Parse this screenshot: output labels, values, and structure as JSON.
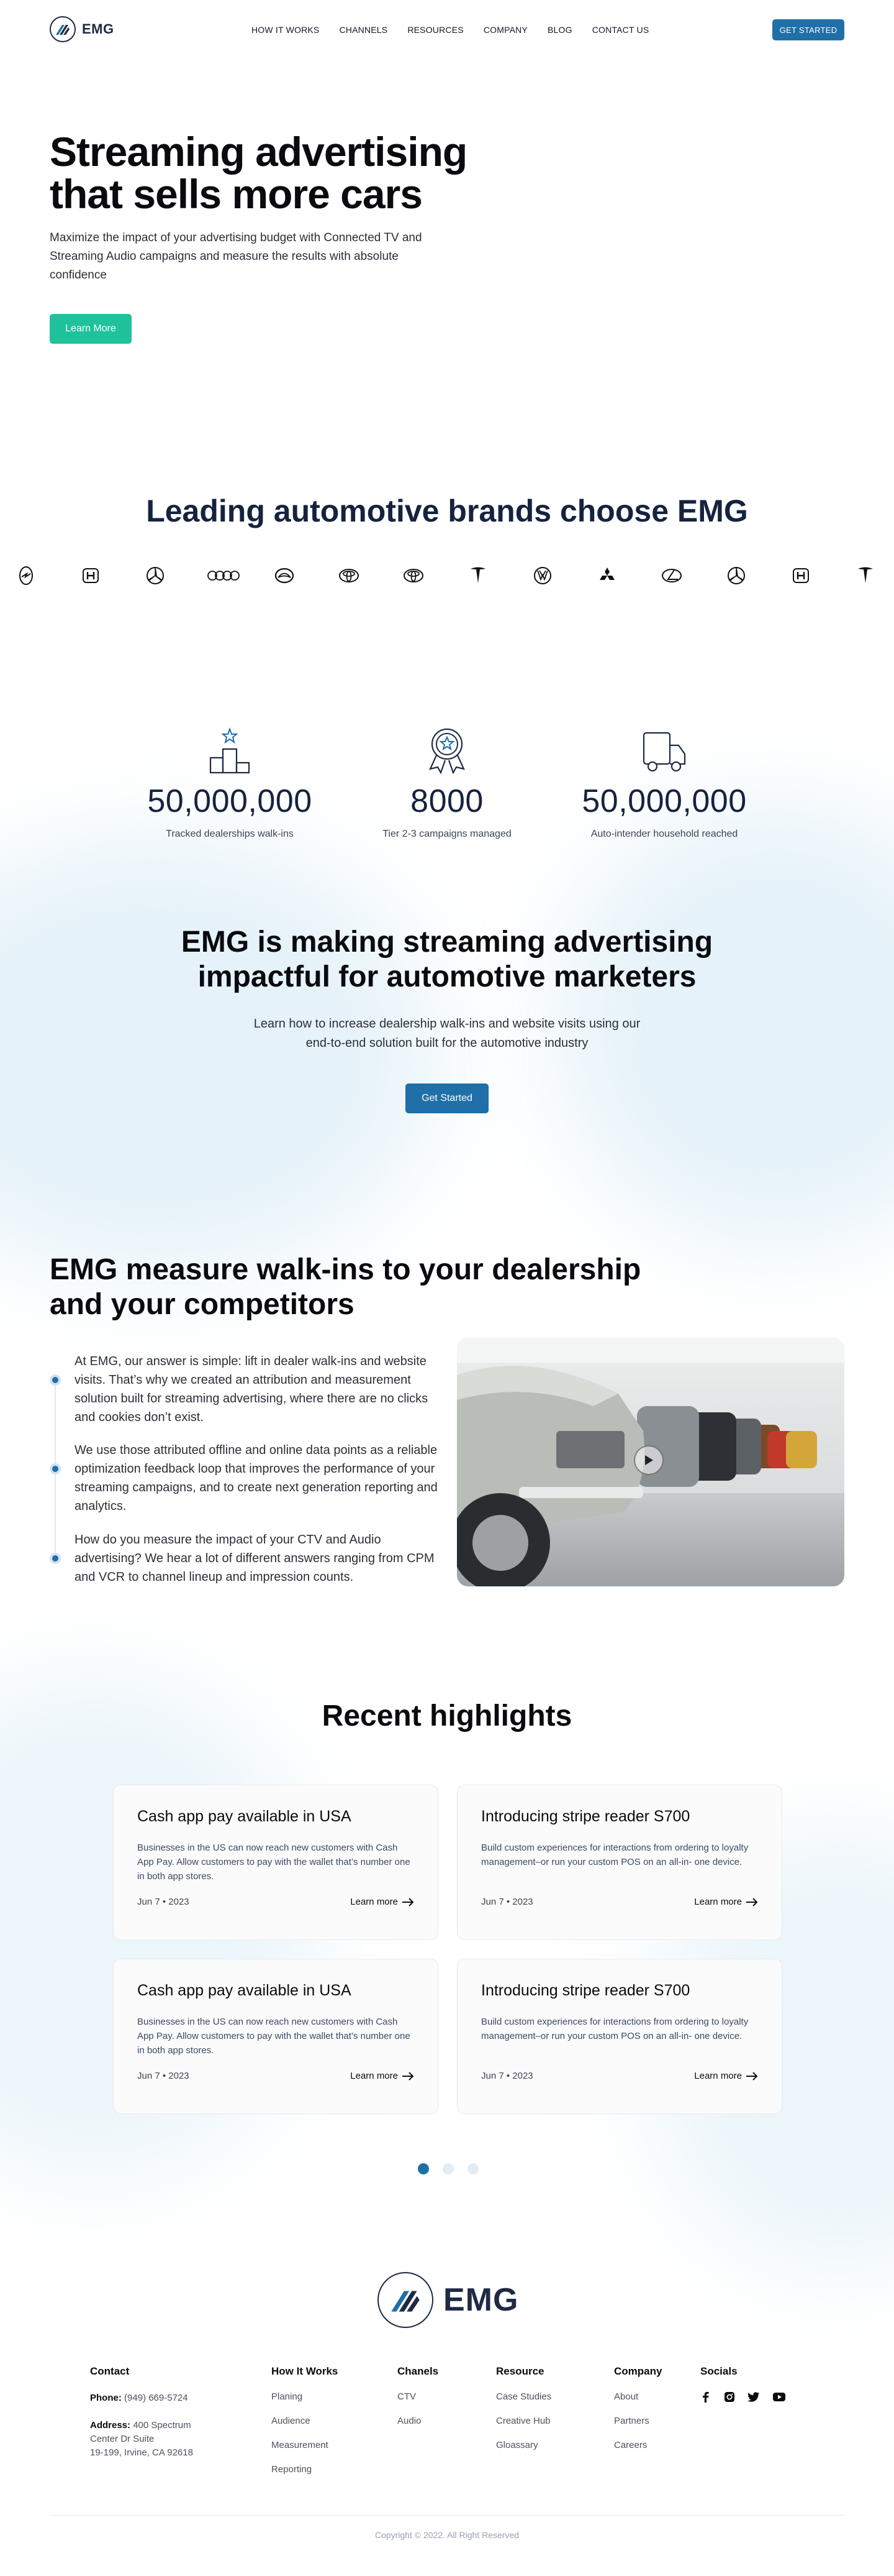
{
  "brand": {
    "name": "EMG"
  },
  "nav": {
    "links": [
      "HOW IT WORKS",
      "CHANNELS",
      "RESOURCES",
      "COMPANY",
      "BLOG",
      "CONTACT US"
    ],
    "cta": "GET STARTED"
  },
  "hero": {
    "title": "Streaming advertising that sells more cars",
    "subtitle": "Maximize the impact of your advertising budget with Connected TV and Streaming Audio campaigns and measure the results with absolute confidence",
    "button": "Learn More"
  },
  "brands": {
    "title": "Leading automotive brands choose EMG",
    "logos": [
      "opel-icon",
      "honda-icon",
      "mercedes-icon",
      "audi-icon",
      "mazda-icon",
      "toyota-icon",
      "toyota-icon",
      "tesla-icon",
      "volkswagen-icon",
      "mitsubishi-icon",
      "lexus-icon",
      "mercedes-icon",
      "honda-icon",
      "tesla-icon"
    ]
  },
  "stats": [
    {
      "icon": "podium-icon",
      "value": "50,000,000",
      "label": "Tracked dealerships walk-ins"
    },
    {
      "icon": "award-icon",
      "value": "8000",
      "label": "Tier 2-3 campaigns managed"
    },
    {
      "icon": "truck-icon",
      "value": "50,000,000",
      "label": "Auto-intender household reached"
    }
  ],
  "mission": {
    "title": "EMG is making streaming advertising impactful for automotive marketers",
    "subtitle": "Learn how to increase dealership walk-ins and website visits using our end-to-end solution built for the automotive industry",
    "button": "Get Started"
  },
  "measure": {
    "title": "EMG measure walk-ins to your dealership and your competitors",
    "points": [
      "At EMG, our answer is simple: lift in dealer walk-ins and website visits. That’s why we created an attribution and measurement solution built for streaming advertising, where there are no clicks and cookies don’t exist.",
      "We use those attributed offline and online data points as a reliable optimization feedback loop that improves the performance of your streaming campaigns, and to create next generation reporting and analytics.",
      "How do you measure the impact of your CTV and Audio advertising? We hear a lot of different answers ranging from CPM and VCR to channel lineup and impression counts."
    ]
  },
  "highlights": {
    "title": "Recent highlights",
    "cards": [
      {
        "title": "Cash app pay available in USA",
        "body": "Businesses in the US can now reach new customers with Cash App Pay. Allow customers to pay with the wallet that’s number one in both app stores.",
        "date": "Jun 7 • 2023",
        "more": "Learn more"
      },
      {
        "title": "Introducing stripe reader  S700",
        "body": "Build custom experiences for interactions from ordering to loyalty management–or run your custom POS on an all-in- one device.",
        "date": "Jun 7 • 2023",
        "more": "Learn more"
      },
      {
        "title": "Cash app pay available in USA",
        "body": "Businesses in the US can now reach new customers with Cash App Pay. Allow customers to pay with the wallet that’s number one in both app stores.",
        "date": "Jun 7 • 2023",
        "more": "Learn more"
      },
      {
        "title": "Introducing stripe reader  S700",
        "body": "Build custom experiences for interactions from ordering to loyalty management–or run your custom POS on an all-in- one device.",
        "date": "Jun 7 • 2023",
        "more": "Learn more"
      }
    ],
    "pagination": {
      "active": 1,
      "total": 3
    }
  },
  "footer": {
    "contact": {
      "heading": "Contact",
      "phone_label": "Phone:",
      "phone": "(949) 669-5724",
      "address_label": "Address:",
      "address_line1": "400 Spectrum",
      "address_line2": "Center Dr Suite",
      "address_line3": "19-199, Irvine, CA 92618"
    },
    "columns": [
      {
        "heading": "How It Works",
        "items": [
          "Planing",
          "Audience",
          "Measurement",
          "Reporting"
        ]
      },
      {
        "heading": "Chanels",
        "items": [
          "CTV",
          "Audio"
        ]
      },
      {
        "heading": "Resource",
        "items": [
          "Case Studies",
          "Creative Hub",
          "Gloassary"
        ]
      },
      {
        "heading": "Company",
        "items": [
          "About",
          "Partners",
          "Careers"
        ]
      }
    ],
    "socials": {
      "heading": "Socials",
      "icons": [
        "facebook-icon",
        "instagram-icon",
        "twitter-icon",
        "youtube-icon"
      ]
    },
    "copyright": "Copyright © 2022. All Right Reserved"
  },
  "colors": {
    "primary": "#1f6fa8",
    "accent": "#1fc29b",
    "navy": "#15233f"
  }
}
